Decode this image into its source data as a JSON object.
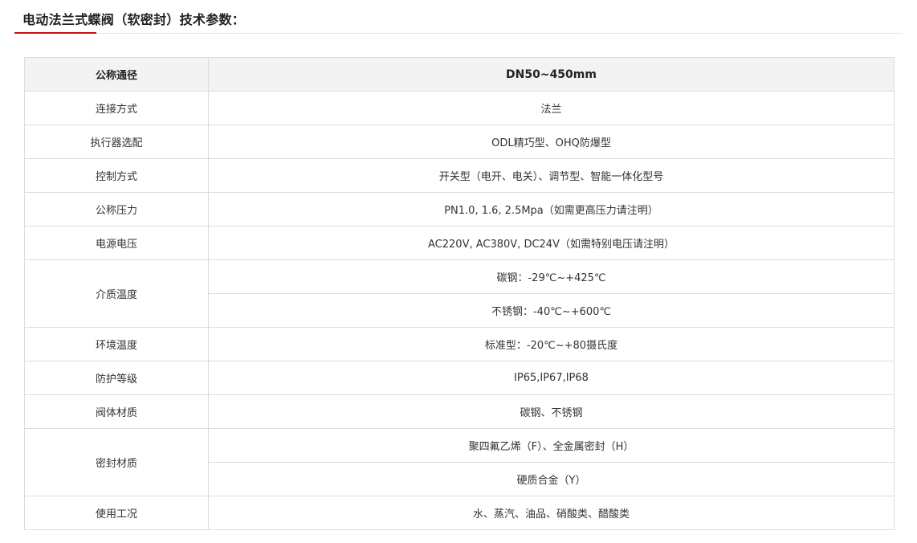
{
  "header": {
    "title": "电动法兰式蝶阀（软密封）技术参数：",
    "accent_color": "#c81010"
  },
  "table": {
    "header": {
      "label": "公称通径",
      "value": "DN50~450mm"
    },
    "rows": [
      {
        "label": "连接方式",
        "values": [
          "法兰"
        ]
      },
      {
        "label": "执行器选配",
        "values": [
          "ODL精巧型、OHQ防爆型"
        ]
      },
      {
        "label": "控制方式",
        "values": [
          "开关型（电开、电关）、调节型、智能一体化型号"
        ]
      },
      {
        "label": "公称压力",
        "values": [
          "PN1.0, 1.6, 2.5Mpa（如需更高压力请注明）"
        ]
      },
      {
        "label": "电源电压",
        "values": [
          "AC220V, AC380V, DC24V（如需特别电压请注明）"
        ]
      },
      {
        "label": "介质温度",
        "values": [
          "碳钢：-29℃~+425℃",
          "不锈钢：-40℃~+600℃"
        ]
      },
      {
        "label": "环境温度",
        "values": [
          "标准型：-20℃~+80摄氏度"
        ]
      },
      {
        "label": "防护等级",
        "values": [
          "IP65,IP67,IP68"
        ]
      },
      {
        "label": "阀体材质",
        "values": [
          "碳钢、不锈钢"
        ]
      },
      {
        "label": "密封材质",
        "values": [
          "聚四氟乙烯（F）、全金属密封（H）",
          "硬质合金（Y）"
        ]
      },
      {
        "label": "使用工况",
        "values": [
          "水、蒸汽、油品、硝酸类、醋酸类"
        ]
      }
    ]
  }
}
